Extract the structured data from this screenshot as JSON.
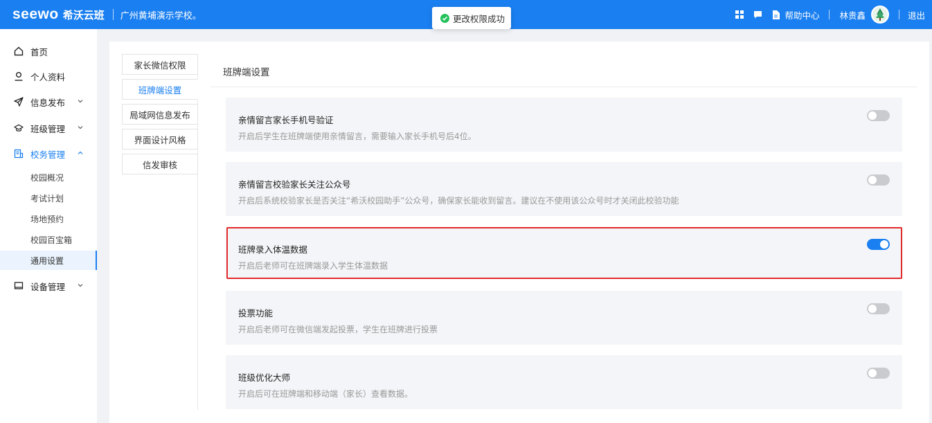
{
  "header": {
    "logo_latin": "seewo",
    "logo_cn": "希沃云班",
    "school": "广州黄埔演示学校。",
    "help_label": "帮助中心",
    "user_name": "林贵鑫",
    "logout_label": "退出",
    "bg_color": "#1a7ff0"
  },
  "toast": {
    "message": "更改权限成功",
    "icon": "check-circle-icon"
  },
  "sidebar": {
    "items": [
      {
        "label": "首页",
        "icon": "home-icon"
      },
      {
        "label": "个人资料",
        "icon": "user-icon"
      },
      {
        "label": "信息发布",
        "icon": "send-icon"
      },
      {
        "label": "班级管理",
        "icon": "graduation-cap-icon"
      },
      {
        "label": "校务管理",
        "icon": "school-affairs-icon"
      },
      {
        "label": "设备管理",
        "icon": "monitor-icon"
      }
    ],
    "sub_items": [
      "校园概况",
      "考试计划",
      "场地预约",
      "校园百宝箱",
      "通用设置"
    ]
  },
  "subnav": {
    "items": [
      "家长微信权限",
      "班牌端设置",
      "局域网信息发布",
      "界面设计风格",
      "信发审核"
    ],
    "active_index": 1
  },
  "section_title": "班牌端设置",
  "settings": [
    {
      "title": "亲情留言家长手机号验证",
      "desc": "开启后学生在班牌端使用亲情留言，需要输入家长手机号后4位。",
      "enabled": false
    },
    {
      "title": "亲情留言校验家长关注公众号",
      "desc": "开启后系统校验家长是否关注“希沃校园助手”公众号，确保家长能收到留言。建议在不使用该公众号时才关闭此校验功能",
      "enabled": false
    },
    {
      "title": "班牌录入体温数据",
      "desc": "开启后老师可在班牌端录入学生体温数据",
      "enabled": true
    },
    {
      "title": "投票功能",
      "desc": "开启后老师可在微信端发起投票，学生在班牌进行投票",
      "enabled": false
    },
    {
      "title": "班级优化大师",
      "desc": "开启后可在班牌端和移动端（家长）查看数据。",
      "enabled": false
    }
  ],
  "colors": {
    "accent": "#1a7ff0",
    "highlight_border": "#e32a2a",
    "toast_success": "#23c25b"
  }
}
